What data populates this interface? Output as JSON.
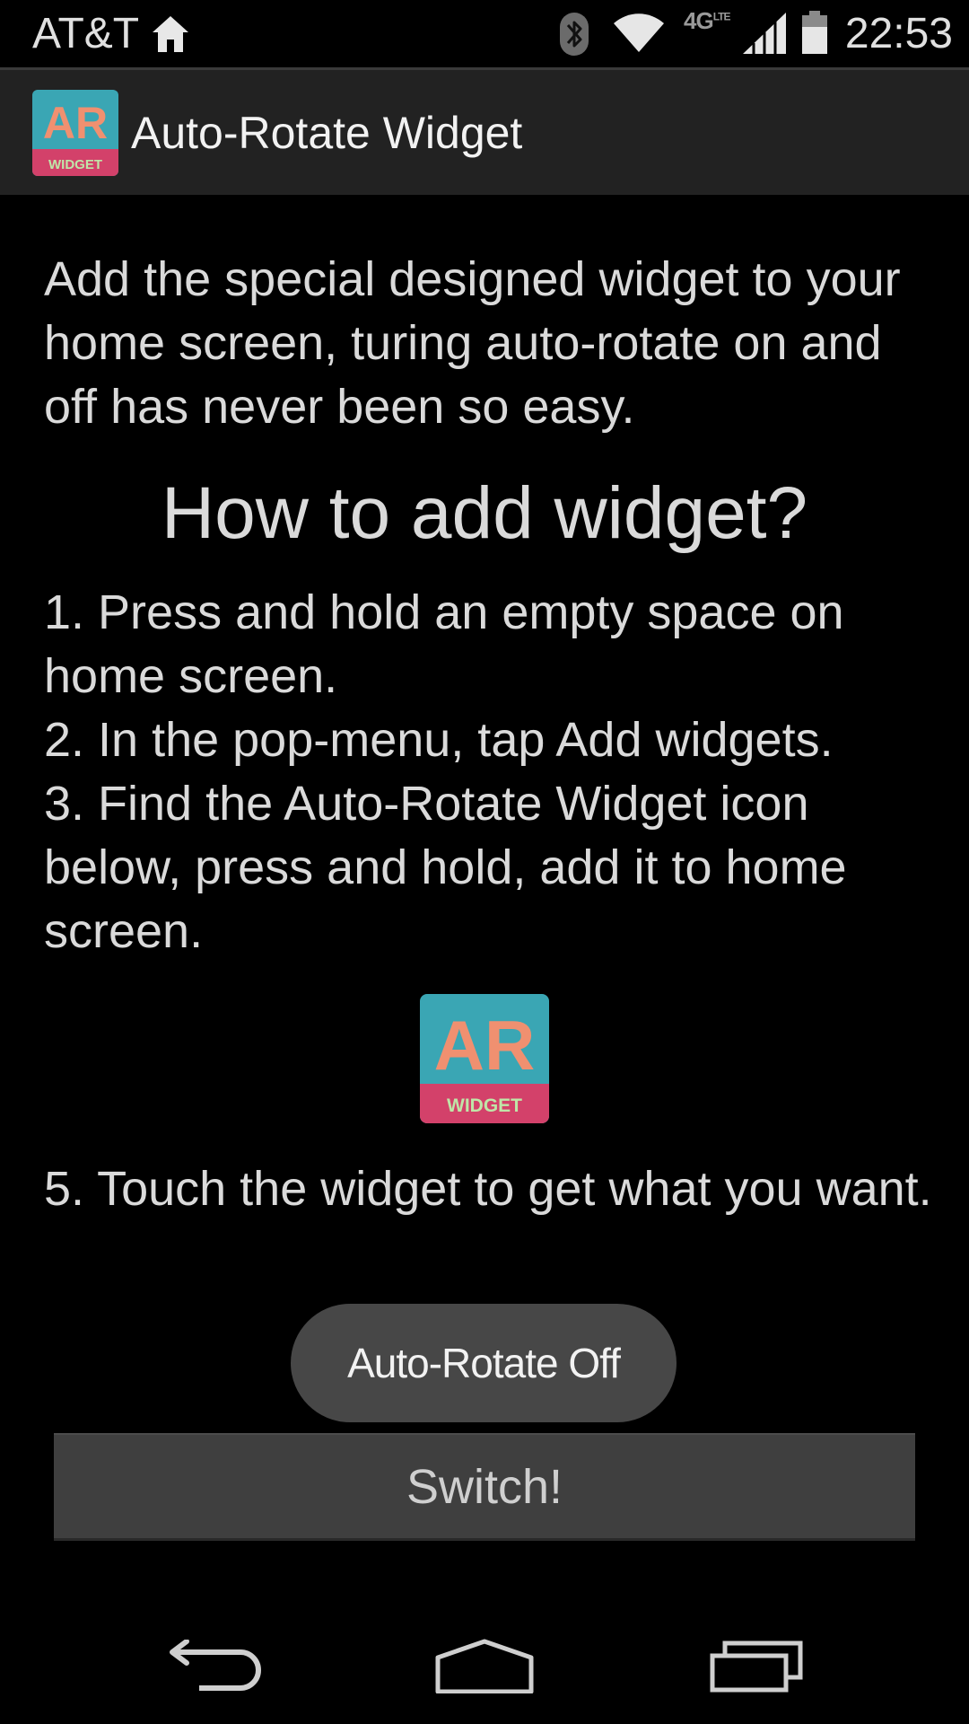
{
  "status_bar": {
    "carrier": "AT&T",
    "network": "4G",
    "network_sub": "LTE",
    "time": "22:53",
    "icons": [
      "home-icon",
      "bluetooth-icon",
      "wifi-icon",
      "signal-icon",
      "battery-icon"
    ]
  },
  "action_bar": {
    "title": "Auto-Rotate Widget",
    "icon": {
      "main_text": "AR",
      "sub_text": "WIDGET"
    }
  },
  "content": {
    "intro": "Add the special designed widget to your home screen, turing auto-rotate on and off has never been so easy.",
    "heading": "How to add widget?",
    "steps": [
      "1. Press and hold an empty space on home screen.",
      "2. In the pop-menu, tap Add widgets.",
      "3. Find the Auto-Rotate Widget icon below, press and hold, add it to home screen."
    ],
    "widget_icon": {
      "main_text": "AR",
      "sub_text": "WIDGET"
    },
    "step5": "5. Touch the widget to get what you want."
  },
  "toast": {
    "text": "Auto-Rotate Off"
  },
  "switch_button": {
    "label": "Switch!"
  },
  "nav_bar": {
    "icons": [
      "back-icon",
      "home-icon",
      "recents-icon"
    ]
  },
  "colors": {
    "icon_teal": "#3aa6b4",
    "icon_letters": "#f09070",
    "icon_band": "#d3416a",
    "icon_band_text": "#bfe6a8",
    "action_bar_bg": "#222222",
    "button_bg": "#3f3f3f",
    "toast_bg": "#474747"
  }
}
